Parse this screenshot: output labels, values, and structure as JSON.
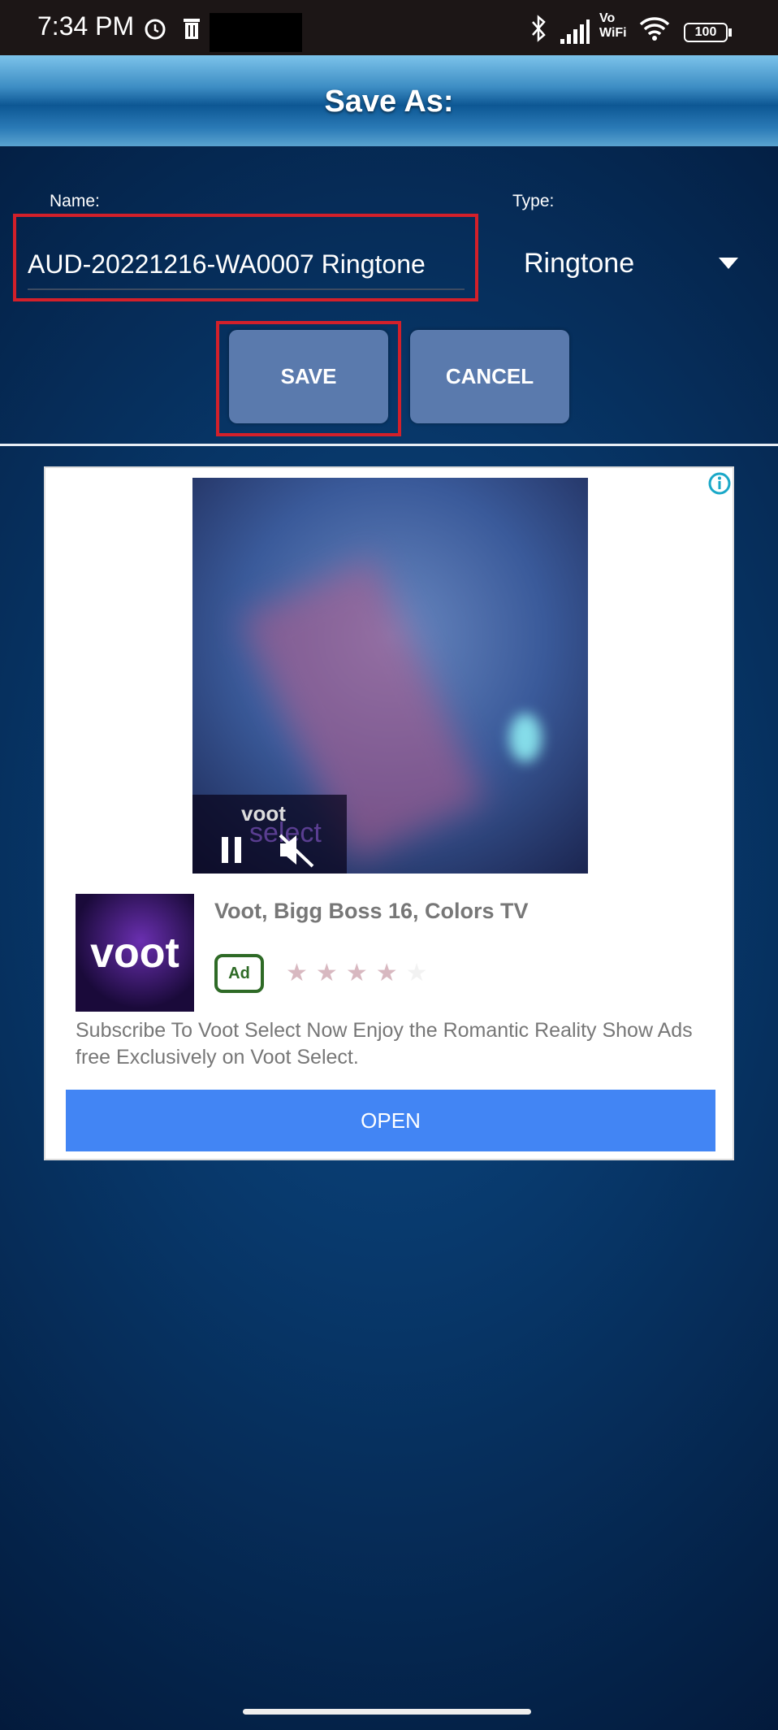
{
  "status_bar": {
    "time": "7:34 PM",
    "battery": "100",
    "icons": [
      "alarm-icon",
      "trash-icon",
      "bluetooth-icon",
      "signal-icon",
      "vowifi-icon",
      "wifi-icon",
      "battery-icon"
    ],
    "vowifi_top": "Vo",
    "vowifi_bottom": "WiFi"
  },
  "header": {
    "title": "Save As:"
  },
  "form": {
    "name_label": "Name:",
    "name_value": "AUD-20221216-WA0007 Ringtone",
    "type_label": "Type:",
    "type_value": "Ringtone"
  },
  "buttons": {
    "save": "SAVE",
    "cancel": "CANCEL"
  },
  "ad": {
    "video_brand_top": "voot",
    "video_brand_bottom": "select",
    "app_icon_text": "voot",
    "title": "Voot, Bigg Boss 16, Colors TV",
    "badge": "Ad",
    "rating": 4,
    "rating_max": 5,
    "description": "Subscribe To Voot Select Now Enjoy the Romantic Reality Show Ads free Exclusively on Voot Select.",
    "cta": "OPEN",
    "cta_color": "#4285f4"
  },
  "colors": {
    "highlight": "#d3202a",
    "button": "#5a7aad"
  }
}
